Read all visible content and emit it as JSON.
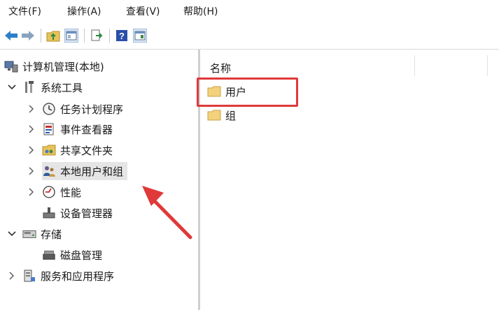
{
  "menubar": {
    "items": [
      {
        "label": "文件(F)"
      },
      {
        "label": "操作(A)"
      },
      {
        "label": "查看(V)"
      },
      {
        "label": "帮助(H)"
      }
    ]
  },
  "tree": {
    "root": {
      "label": "计算机管理(本地)",
      "icon": "computer-management-icon"
    },
    "system_tools": {
      "label": "系统工具",
      "icon": "tools-icon",
      "expanded": true
    },
    "task_scheduler": {
      "label": "任务计划程序",
      "icon": "clock-icon"
    },
    "event_viewer": {
      "label": "事件查看器",
      "icon": "event-viewer-icon"
    },
    "shared_folders": {
      "label": "共享文件夹",
      "icon": "shared-folder-icon"
    },
    "local_users": {
      "label": "本地用户和组",
      "icon": "users-icon",
      "selected": true
    },
    "performance": {
      "label": "性能",
      "icon": "performance-icon"
    },
    "device_manager": {
      "label": "设备管理器",
      "icon": "device-manager-icon"
    },
    "storage": {
      "label": "存储",
      "icon": "storage-icon",
      "expanded": true
    },
    "disk_management": {
      "label": "磁盘管理",
      "icon": "disk-icon"
    },
    "services_apps": {
      "label": "服务和应用程序",
      "icon": "services-icon"
    }
  },
  "list": {
    "column_header": "名称",
    "items": [
      {
        "label": "用户",
        "icon": "folder-icon"
      },
      {
        "label": "组",
        "icon": "folder-icon"
      }
    ]
  },
  "colors": {
    "highlight_box": "#e0393a",
    "arrow": "#e0393a",
    "selection": "#e5e5e5"
  }
}
